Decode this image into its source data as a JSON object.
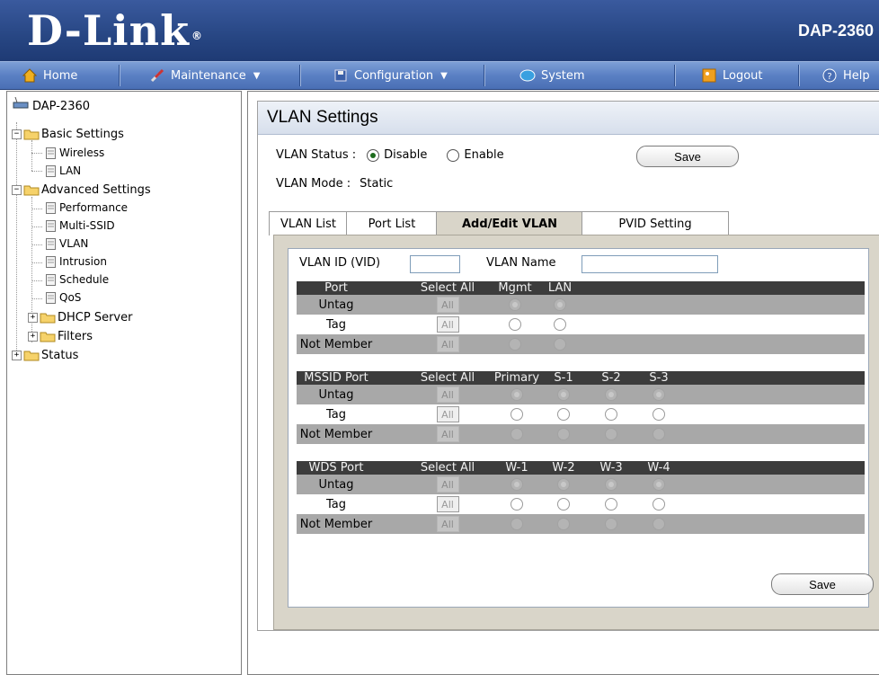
{
  "header": {
    "brand": "D-Link",
    "registered": "®",
    "model": "DAP-2360"
  },
  "menu": {
    "home": "Home",
    "maintenance": "Maintenance",
    "configuration": "Configuration",
    "system": "System",
    "logout": "Logout",
    "help": "Help"
  },
  "tree": {
    "root": "DAP-2360",
    "basic": "Basic Settings",
    "wireless": "Wireless",
    "lan": "LAN",
    "advanced": "Advanced Settings",
    "performance": "Performance",
    "multissid": "Multi-SSID",
    "vlan": "VLAN",
    "intrusion": "Intrusion",
    "schedule": "Schedule",
    "qos": "QoS",
    "dhcp": "DHCP Server",
    "filters": "Filters",
    "status": "Status"
  },
  "page": {
    "title": "VLAN Settings",
    "status_label": "VLAN Status :",
    "disable": "Disable",
    "enable": "Enable",
    "save": "Save",
    "mode_label": "VLAN Mode :",
    "mode_value": "Static"
  },
  "tabs": [
    "VLAN List",
    "Port List",
    "Add/Edit VLAN",
    "PVID Setting"
  ],
  "form": {
    "vid_label": "VLAN ID (VID)",
    "vid_value": "",
    "name_label": "VLAN Name",
    "name_value": ""
  },
  "grid": {
    "port_header": [
      "Port",
      "Select All",
      "Mgmt",
      "LAN"
    ],
    "mssid_header": [
      "MSSID Port",
      "Select All",
      "Primary",
      "S-1",
      "S-2",
      "S-3"
    ],
    "wds_header": [
      "WDS Port",
      "Select All",
      "W-1",
      "W-2",
      "W-3",
      "W-4"
    ],
    "rows": [
      "Untag",
      "Tag",
      "Not Member"
    ],
    "all": "All"
  },
  "colors": {
    "brand_blue": "#274683",
    "menu_blue": "#5a80c4",
    "tab_bg": "#d9d5c9",
    "grid_head": "#3c3c3c"
  }
}
